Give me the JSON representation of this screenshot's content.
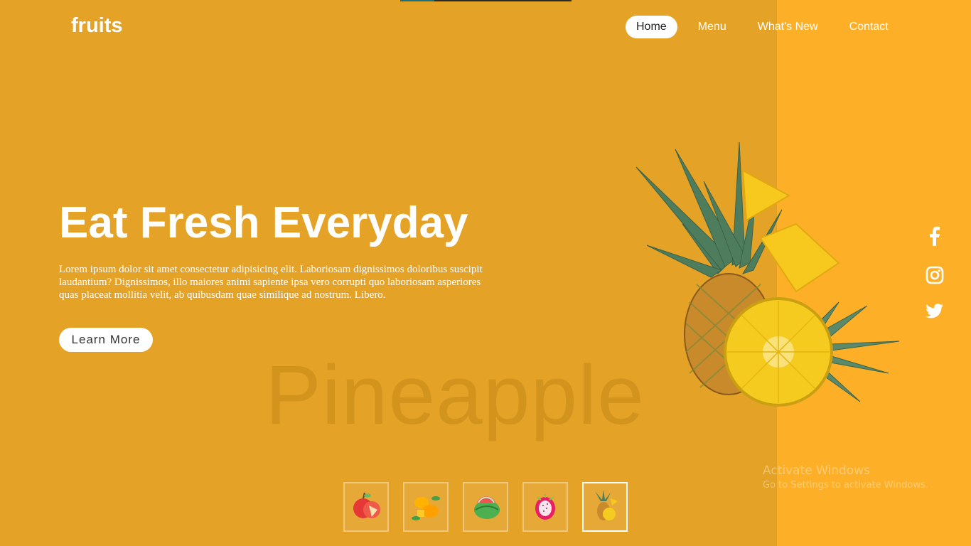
{
  "brand": {
    "logo": "fruits"
  },
  "nav": [
    {
      "label": "Home",
      "active": true
    },
    {
      "label": "Menu",
      "active": false
    },
    {
      "label": "What's New",
      "active": false
    },
    {
      "label": "Contact",
      "active": false
    }
  ],
  "hero": {
    "title": "Eat Fresh Everyday",
    "description": "Lorem ipsum dolor sit amet consectetur adipisicing elit. Laboriosam dignissimos doloribus suscipit laudantium? Dignissimos, illo maiores animi sapiente ipsa vero corrupti quo laboriosam asperiores quas placeat mollitia velit, ab quibusdam quae similique ad nostrum. Libero.",
    "button": "Learn More",
    "fruit_name": "Pineapple"
  },
  "social": [
    "facebook-icon",
    "instagram-icon",
    "twitter-icon"
  ],
  "thumbnails": [
    {
      "name": "apple",
      "active": false
    },
    {
      "name": "mango",
      "active": false
    },
    {
      "name": "watermelon",
      "active": false
    },
    {
      "name": "dragon-fruit",
      "active": false
    },
    {
      "name": "pineapple",
      "active": true
    }
  ],
  "os_watermark": {
    "line1": "Activate Windows",
    "line2": "Go to Settings to activate Windows."
  },
  "colors": {
    "background": "#e4a227",
    "right_panel": "#fdb027",
    "text": "#ffffff"
  }
}
